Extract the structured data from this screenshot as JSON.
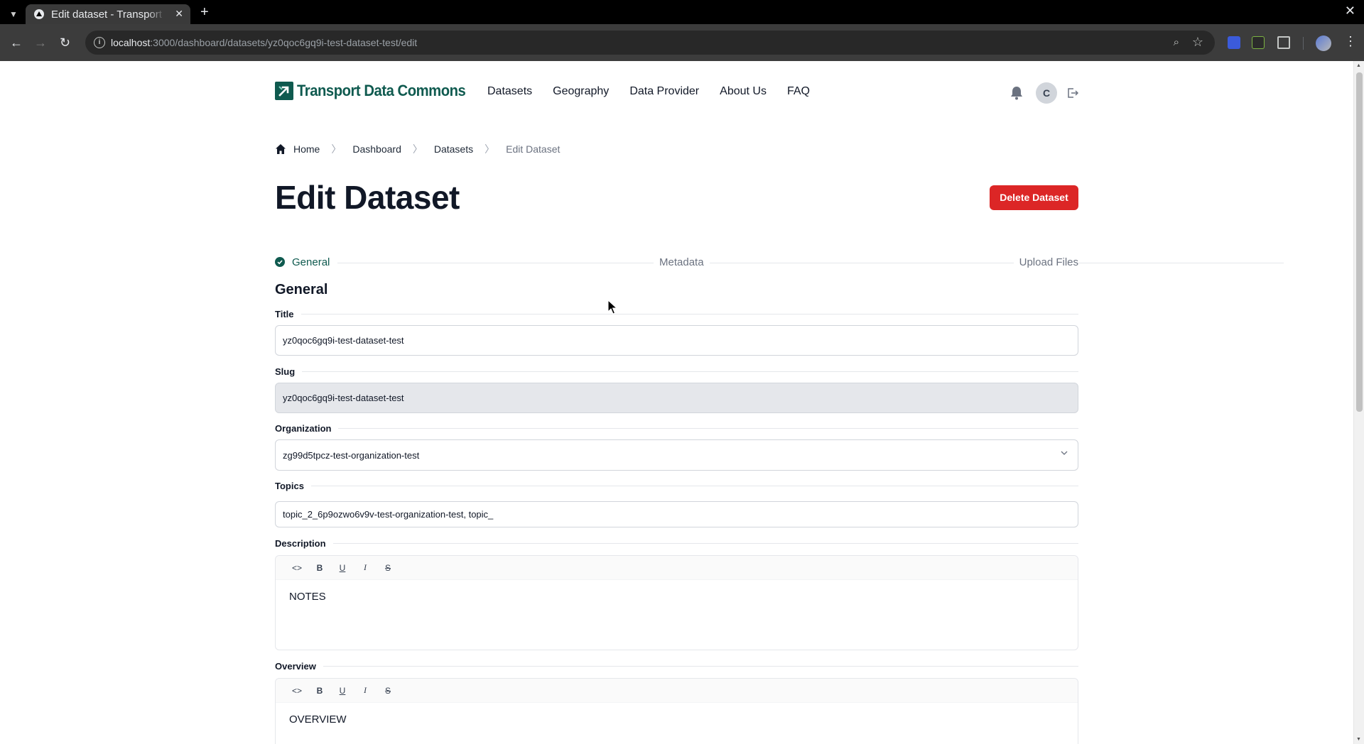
{
  "browser": {
    "tab_title": "Edit dataset - Transport Data Commons",
    "url_host": "localhost",
    "url_path": ":3000/dashboard/datasets/yz0qoc6gq9i-test-dataset-test/edit"
  },
  "header": {
    "logo_text": "Transport Data Commons",
    "nav": [
      "Datasets",
      "Geography",
      "Data Provider",
      "About Us",
      "FAQ"
    ],
    "avatar_initial": "C"
  },
  "breadcrumb": {
    "items": [
      "Home",
      "Dashboard",
      "Datasets"
    ],
    "current": "Edit Dataset"
  },
  "page": {
    "title": "Edit Dataset",
    "delete_label": "Delete Dataset"
  },
  "stepper": {
    "steps": [
      "General",
      "Metadata",
      "Upload Files"
    ],
    "active_step": "General"
  },
  "form": {
    "section_title": "General",
    "title_label": "Title",
    "title_value": "yz0qoc6gq9i-test-dataset-test",
    "slug_label": "Slug",
    "slug_value": "yz0qoc6gq9i-test-dataset-test",
    "organization_label": "Organization",
    "organization_value": "zg99d5tpcz-test-organization-test",
    "topics_label": "Topics",
    "topics_value": "topic_2_6p9ozwo6v9v-test-organization-test, topic_",
    "description_label": "Description",
    "description_value": "NOTES",
    "overview_label": "Overview",
    "overview_value": "OVERVIEW"
  },
  "editor_toolbar": [
    "code-icon",
    "bold-icon",
    "underline-icon",
    "italic-icon",
    "strikethrough-icon"
  ],
  "colors": {
    "brand": "#0f5a4f",
    "danger": "#dc2626"
  }
}
